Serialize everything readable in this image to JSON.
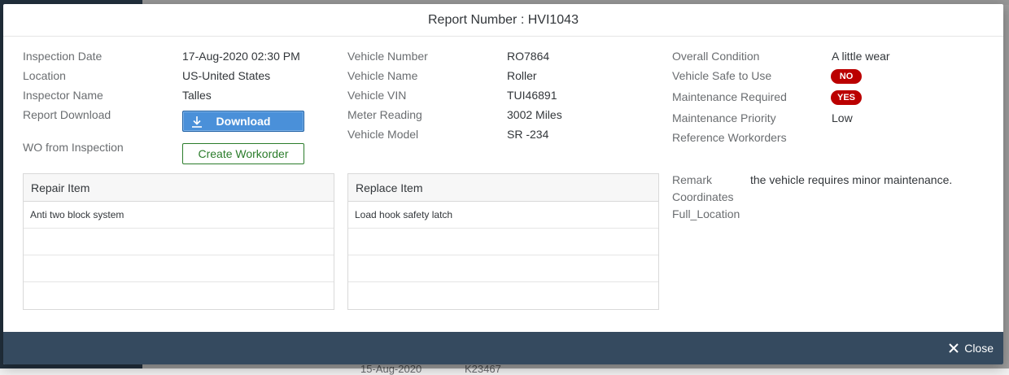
{
  "dialog": {
    "title": "Report Number : HVI1043"
  },
  "col1": {
    "inspection_date_label": "Inspection Date",
    "inspection_date_value": "17-Aug-2020 02:30 PM",
    "location_label": "Location",
    "location_value": "US-United States",
    "inspector_label": "Inspector Name",
    "inspector_value": "Talles",
    "report_download_label": "Report Download",
    "download_button": "Download",
    "wo_label": "WO from Inspection",
    "create_wo_button": "Create Workorder"
  },
  "col2": {
    "vehicle_number_label": "Vehicle Number",
    "vehicle_number_value": "RO7864",
    "vehicle_name_label": "Vehicle Name",
    "vehicle_name_value": "Roller",
    "vehicle_vin_label": "Vehicle VIN",
    "vehicle_vin_value": "TUI46891",
    "meter_label": "Meter Reading",
    "meter_value": "3002 Miles",
    "model_label": "Vehicle Model",
    "model_value": "SR -234"
  },
  "col3": {
    "overall_label": "Overall Condition",
    "overall_value": "A little wear",
    "safe_label": "Vehicle Safe to Use",
    "safe_value": "NO",
    "maint_req_label": "Maintenance Required",
    "maint_req_value": "YES",
    "priority_label": "Maintenance Priority",
    "priority_value": "Low",
    "ref_wo_label": "Reference Workorders",
    "remark_label": "Remark",
    "remark_value": "the vehicle requires minor maintenance.",
    "coordinates_label": "Coordinates",
    "full_location_label": "Full_Location"
  },
  "repair_table": {
    "header": "Repair Item",
    "rows": [
      "Anti two block system",
      "",
      "",
      ""
    ]
  },
  "replace_table": {
    "header": "Replace Item",
    "rows": [
      "Load hook safety latch",
      "",
      "",
      ""
    ]
  },
  "footer": {
    "close_label": "Close"
  },
  "background": {
    "date_text": "15-Aug-2020",
    "id_text": "K23467"
  },
  "colors": {
    "badge_red": "#bb0000",
    "footer_bg": "#354a5f",
    "primary_blue": "#4a90d9",
    "positive_green": "#2b7c2b"
  }
}
